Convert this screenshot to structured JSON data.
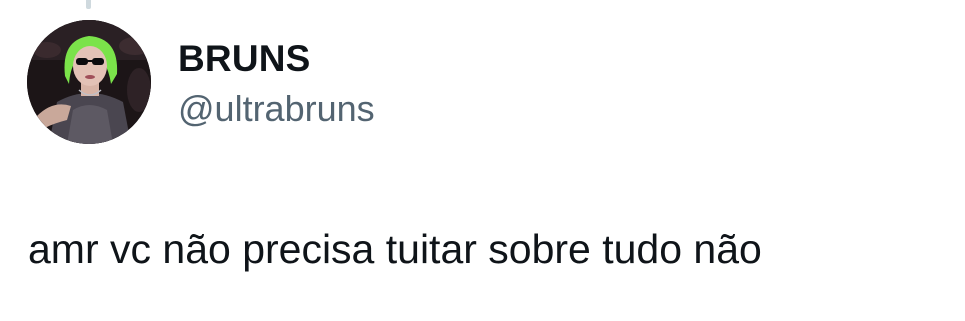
{
  "tweet": {
    "author": {
      "display_name": "BRUNS",
      "handle": "@ultrabruns",
      "avatar_icon": "profile-photo"
    },
    "text": "amr vc não precisa tuitar sobre tudo não"
  },
  "colors": {
    "text_primary": "#0f1419",
    "text_secondary": "#536471",
    "thread_line": "#cfd9de",
    "avatar_hair": "#7be34a",
    "background": "#ffffff"
  }
}
